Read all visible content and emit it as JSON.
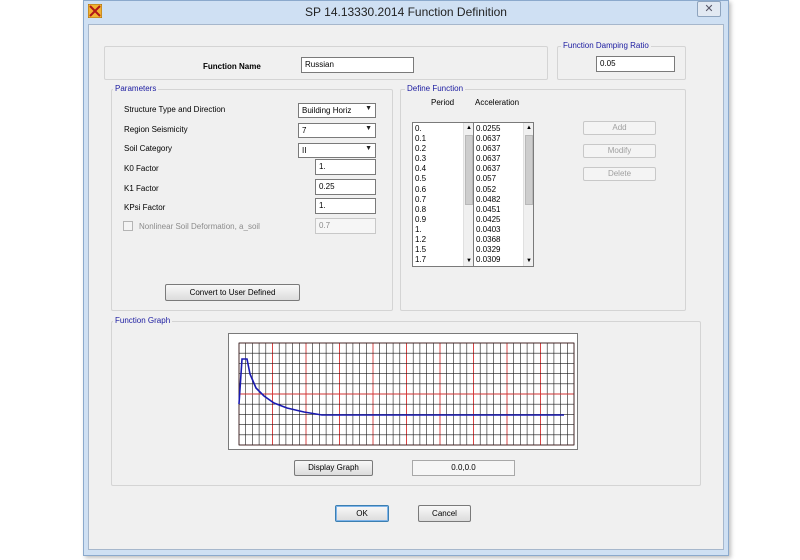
{
  "window": {
    "title": "SP 14.13330.2014 Function Definition",
    "close_glyph": "✕"
  },
  "function_name": {
    "label": "Function Name",
    "value": "Russian"
  },
  "damping": {
    "group_label": "Function Damping Ratio",
    "value": "0.05"
  },
  "parameters": {
    "group_label": "Parameters",
    "structure_type": {
      "label": "Structure Type and Direction",
      "value": "Building Horiz"
    },
    "region_seismicity": {
      "label": "Region Seismicity",
      "value": "7"
    },
    "soil_category": {
      "label": "Soil Category",
      "value": "II"
    },
    "k0_factor": {
      "label": "K0 Factor",
      "value": "1."
    },
    "k1_factor": {
      "label": "K1 Factor",
      "value": "0.25"
    },
    "kpsi_factor": {
      "label": "KPsi Factor",
      "value": "1."
    },
    "nonlinear": {
      "label": "Nonlinear Soil Deformation, a_soil",
      "value": "0.7"
    },
    "convert_button": "Convert to User Defined"
  },
  "define_function": {
    "group_label": "Define Function",
    "period_header": "Period",
    "acceleration_header": "Acceleration",
    "periods": [
      "0.",
      "0.1",
      "0.2",
      "0.3",
      "0.4",
      "0.5",
      "0.6",
      "0.7",
      "0.8",
      "0.9",
      "1.",
      "1.2",
      "1.5",
      "1.7"
    ],
    "accelerations": [
      "0.0255",
      "0.0637",
      "0.0637",
      "0.0637",
      "0.0637",
      "0.057",
      "0.052",
      "0.0482",
      "0.0451",
      "0.0425",
      "0.0403",
      "0.0368",
      "0.0329",
      "0.0309"
    ],
    "add_button": "Add",
    "modify_button": "Modify",
    "delete_button": "Delete"
  },
  "function_graph": {
    "group_label": "Function Graph",
    "display_button": "Display Graph",
    "coord_readout": "0.0,0.0"
  },
  "footer": {
    "ok_button": "OK",
    "cancel_button": "Cancel"
  },
  "colors": {
    "title_accent": "#1a1aa0",
    "graph_line": "#1a1ab0",
    "grid_major": "#d23030",
    "grid_minor": "#1a1a1a"
  }
}
